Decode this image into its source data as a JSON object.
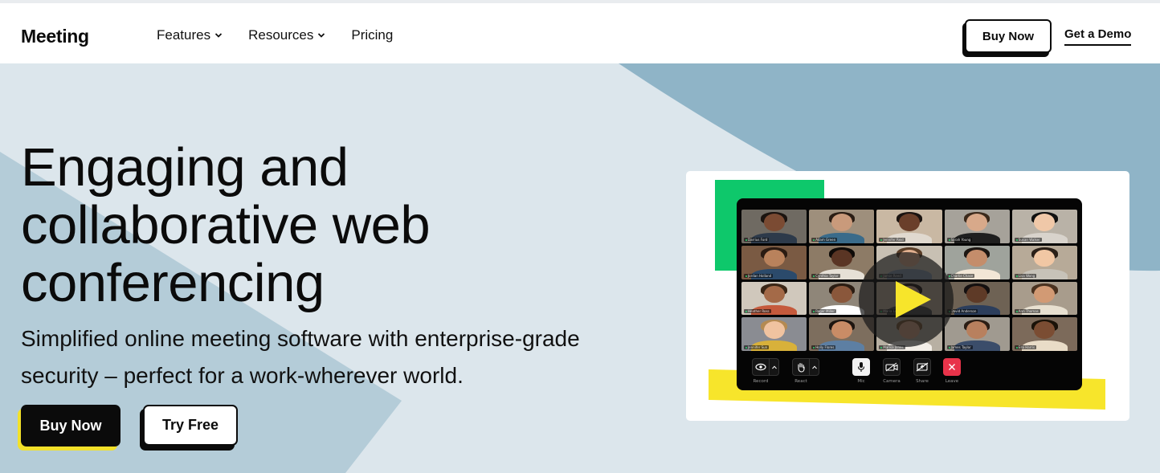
{
  "nav": {
    "logo": "Meeting",
    "links": [
      {
        "label": "Features",
        "has_dropdown": true
      },
      {
        "label": "Resources",
        "has_dropdown": true
      },
      {
        "label": "Pricing",
        "has_dropdown": false
      }
    ],
    "buy_now_label": "Buy Now",
    "get_demo_label": "Get a Demo"
  },
  "hero": {
    "headline_lines": [
      "Engaging and",
      "collaborative web",
      "conferencing"
    ],
    "subhead_lines": [
      "Simplified online meeting software with enterprise-grade",
      "security – perfect for a work-wherever world."
    ],
    "buy_now_label": "Buy Now",
    "try_free_label": "Try Free"
  },
  "video_preview": {
    "participants": [
      "Darrius Ford",
      "Adam Green",
      "Jennifer Reid",
      "Sarah Young",
      "Susan Walker",
      "Jordan Holland",
      "Cynthia Taylor",
      "Jamie Reed",
      "Charlie Chase",
      "Lisa Wong",
      "Heather Ross",
      "Roger Miller",
      "Maria Lopez",
      "David Anderson",
      "Ann Thomas",
      "Jennifer Sun",
      "Holly Flores",
      "Marisa Jones",
      "James Taylor",
      "Ella Harris"
    ],
    "controls": [
      {
        "label": "Record",
        "icon": "eye-icon"
      },
      {
        "label": "React",
        "icon": "hand-icon"
      },
      {
        "label": "Mic",
        "icon": "mic-icon"
      },
      {
        "label": "Camera",
        "icon": "camera-off-icon"
      },
      {
        "label": "Share",
        "icon": "share-off-icon"
      },
      {
        "label": "Leave",
        "icon": "close-icon"
      }
    ]
  },
  "colors": {
    "hero_bg": "#dce6ec",
    "hero_shape_dark": "#8fb4c7",
    "hero_shape_mid": "#b4ccd8",
    "accent_yellow": "#f7e52b",
    "accent_green": "#0ec86b",
    "leave_red": "#e8334a"
  }
}
